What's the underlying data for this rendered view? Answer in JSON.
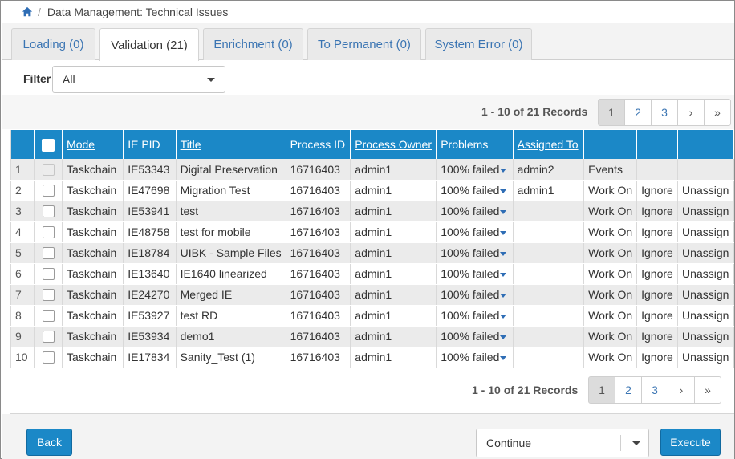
{
  "breadcrumb": {
    "home_icon": "home-icon",
    "separator": "/",
    "current": "Data Management: Technical Issues"
  },
  "tabs": [
    {
      "label": "Loading (0)",
      "active": false
    },
    {
      "label": "Validation (21)",
      "active": true
    },
    {
      "label": "Enrichment (0)",
      "active": false
    },
    {
      "label": "To Permanent (0)",
      "active": false
    },
    {
      "label": "System Error (0)",
      "active": false
    }
  ],
  "filter": {
    "label": "Filter",
    "value": "All"
  },
  "pagination": {
    "records_text": "1 - 10 of 21 Records",
    "pages": [
      "1",
      "2",
      "3"
    ],
    "current_page": "1",
    "next": "›",
    "last": "»"
  },
  "table": {
    "columns": [
      "",
      "",
      "Mode",
      "IE PID",
      "Title",
      "Process ID",
      "Process Owner",
      "Problems",
      "Assigned To",
      "",
      "",
      ""
    ],
    "rows": [
      {
        "num": "1",
        "mode": "Taskchain",
        "ie_pid": "IE53343",
        "title": "Digital Preservation",
        "process_id": "16716403",
        "owner": "admin1",
        "problems": "100% failed",
        "assigned": "admin2",
        "a1": "Events",
        "a2": "",
        "a3": "",
        "checkbox_disabled": true
      },
      {
        "num": "2",
        "mode": "Taskchain",
        "ie_pid": "IE47698",
        "title": "Migration Test",
        "process_id": "16716403",
        "owner": "admin1",
        "problems": "100% failed",
        "assigned": "admin1",
        "a1": "Work On",
        "a2": "Ignore",
        "a3": "Unassign",
        "checkbox_disabled": false
      },
      {
        "num": "3",
        "mode": "Taskchain",
        "ie_pid": "IE53941",
        "title": "test",
        "process_id": "16716403",
        "owner": "admin1",
        "problems": "100% failed",
        "assigned": "",
        "a1": "Work On",
        "a2": "Ignore",
        "a3": "Unassign",
        "checkbox_disabled": false
      },
      {
        "num": "4",
        "mode": "Taskchain",
        "ie_pid": "IE48758",
        "title": "test for mobile",
        "process_id": "16716403",
        "owner": "admin1",
        "problems": "100% failed",
        "assigned": "",
        "a1": "Work On",
        "a2": "Ignore",
        "a3": "Unassign",
        "checkbox_disabled": false
      },
      {
        "num": "5",
        "mode": "Taskchain",
        "ie_pid": "IE18784",
        "title": "UIBK - Sample Files",
        "process_id": "16716403",
        "owner": "admin1",
        "problems": "100% failed",
        "assigned": "",
        "a1": "Work On",
        "a2": "Ignore",
        "a3": "Unassign",
        "checkbox_disabled": false
      },
      {
        "num": "6",
        "mode": "Taskchain",
        "ie_pid": "IE13640",
        "title": "IE1640 linearized",
        "process_id": "16716403",
        "owner": "admin1",
        "problems": "100% failed",
        "assigned": "",
        "a1": "Work On",
        "a2": "Ignore",
        "a3": "Unassign",
        "checkbox_disabled": false
      },
      {
        "num": "7",
        "mode": "Taskchain",
        "ie_pid": "IE24270",
        "title": "Merged IE",
        "process_id": "16716403",
        "owner": "admin1",
        "problems": "100% failed",
        "assigned": "",
        "a1": "Work On",
        "a2": "Ignore",
        "a3": "Unassign",
        "checkbox_disabled": false
      },
      {
        "num": "8",
        "mode": "Taskchain",
        "ie_pid": "IE53927",
        "title": "test RD",
        "process_id": "16716403",
        "owner": "admin1",
        "problems": "100% failed",
        "assigned": "",
        "a1": "Work On",
        "a2": "Ignore",
        "a3": "Unassign",
        "checkbox_disabled": false
      },
      {
        "num": "9",
        "mode": "Taskchain",
        "ie_pid": "IE53934",
        "title": "demo1",
        "process_id": "16716403",
        "owner": "admin1",
        "problems": "100% failed",
        "assigned": "",
        "a1": "Work On",
        "a2": "Ignore",
        "a3": "Unassign",
        "checkbox_disabled": false
      },
      {
        "num": "10",
        "mode": "Taskchain",
        "ie_pid": "IE17834",
        "title": "Sanity_Test (1)",
        "process_id": "16716403",
        "owner": "admin1",
        "problems": "100% failed",
        "assigned": "",
        "a1": "Work On",
        "a2": "Ignore",
        "a3": "Unassign",
        "checkbox_disabled": false
      }
    ]
  },
  "footer": {
    "back_label": "Back",
    "action_value": "Continue",
    "execute_label": "Execute"
  },
  "colors": {
    "primary": "#1b88c7",
    "link": "#2e6db5",
    "row_alt": "#ebebeb"
  }
}
